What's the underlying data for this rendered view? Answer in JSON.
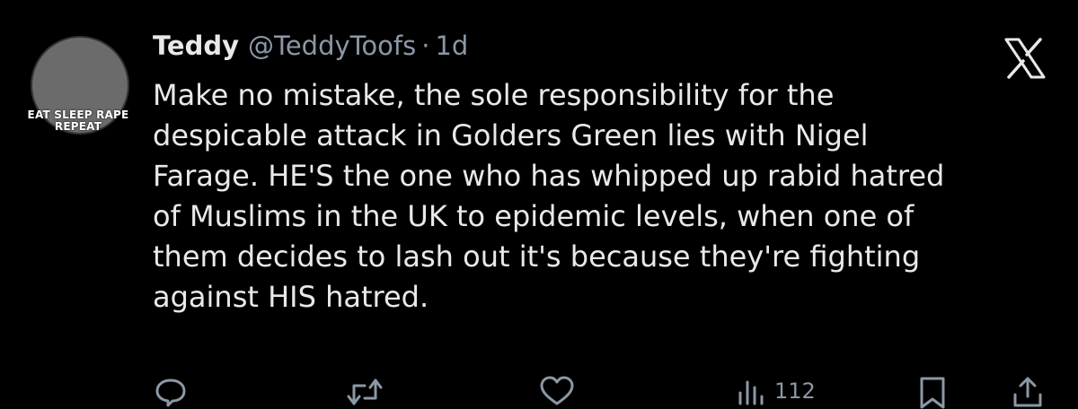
{
  "avatar": {
    "caption_line1": "EAT SLEEP RAPE",
    "caption_line2": "REPEAT"
  },
  "author": {
    "display_name": "Teddy",
    "handle": "@TeddyToofs",
    "separator": "·",
    "time": "1d"
  },
  "tweet": {
    "text": "Make no mistake, the sole responsibility for the\ndespicable attack in Golders Green lies with Nigel\nFarage. HE'S the one who has whipped up rabid hatred\nof Muslims in the UK to epidemic levels, when one of\nthem decides to lash out it's because they're fighting\nagainst HIS hatred."
  },
  "actions": {
    "views": "112"
  },
  "icons": {
    "logo": "x-logo-icon",
    "reply": "reply-icon",
    "retweet": "retweet-icon",
    "like": "like-icon",
    "views": "views-icon",
    "bookmark": "bookmark-icon",
    "share": "share-icon"
  },
  "colors": {
    "background": "#000000",
    "primary_text": "#e7e9ea",
    "secondary_text": "#8b98a5"
  }
}
